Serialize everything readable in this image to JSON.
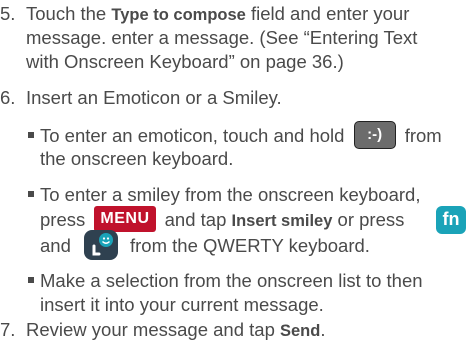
{
  "steps": [
    {
      "num": "5.",
      "pre": "Touch the ",
      "field": "Type to compose",
      "post": " field and enter your",
      "line2": "message. enter a message. (See “Entering Text",
      "line3": "with Onscreen Keyboard” on page 36.)"
    },
    {
      "num": "6.",
      "text": "Insert an Emoticon or a Smiley."
    },
    {
      "num": "7.",
      "pre": "Review your message and tap ",
      "send": "Send",
      "post": "."
    }
  ],
  "bullets": [
    {
      "pre": "To enter an emoticon, touch and hold ",
      "key": ":-)",
      "post": " from",
      "line2": "the onscreen keyboard."
    },
    {
      "line1": "To enter a smiley from the onscreen keyboard,",
      "pre": "press ",
      "menu_key": "MENU",
      "mid": " and tap ",
      "action": "Insert smiley",
      "post": " or press",
      "fn_key": "fn",
      "line3_a": "and",
      "line3_b": "from the QWERTY keyboard."
    },
    {
      "line1": "Make a selection from the onscreen list to then",
      "line2": "insert it into your current message."
    }
  ],
  "colors": {
    "text": "#4a4a4a",
    "menu_key": "#c0122c",
    "fn_key": "#1aa3b8",
    "smiley_key": "#6c6c6c",
    "emoticon_key": "#2f4150"
  },
  "icons": {
    "emoticon_key": "emoticon-key-icon"
  }
}
